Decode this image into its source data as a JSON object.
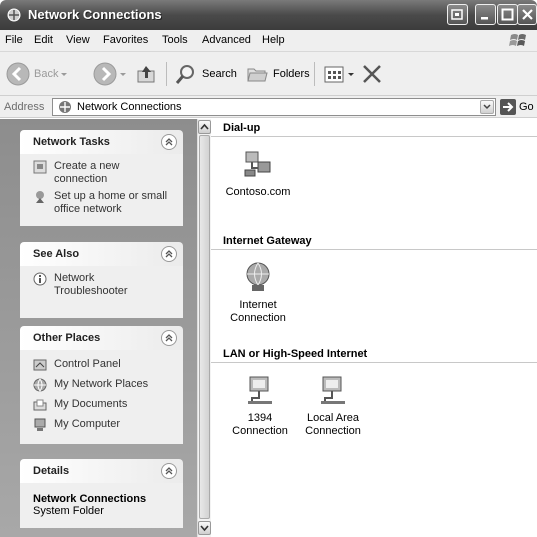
{
  "window": {
    "title": "Network Connections"
  },
  "menu": [
    "File",
    "Edit",
    "View",
    "Favorites",
    "Tools",
    "Advanced",
    "Help"
  ],
  "toolbar": {
    "back": "Back",
    "search": "Search",
    "folders": "Folders"
  },
  "address": {
    "label": "Address",
    "value": "Network Connections",
    "go": "Go"
  },
  "panels": {
    "network_tasks": {
      "title": "Network Tasks",
      "items": [
        "Create a new connection",
        "Set up a home or small office network"
      ]
    },
    "see_also": {
      "title": "See Also",
      "items": [
        "Network Troubleshooter"
      ]
    },
    "other_places": {
      "title": "Other Places",
      "items": [
        "Control Panel",
        "My Network Places",
        "My Documents",
        "My Computer"
      ]
    },
    "details": {
      "title": "Details",
      "name": "Network Connections",
      "sub": "System Folder"
    }
  },
  "groups": {
    "dialup": {
      "title": "Dial-up",
      "items": [
        "Contoso.com"
      ]
    },
    "gateway": {
      "title": "Internet Gateway",
      "items": [
        "Internet Connection"
      ]
    },
    "lan": {
      "title": "LAN or High-Speed Internet",
      "items": [
        "1394 Connection",
        "Local Area Connection"
      ]
    }
  }
}
